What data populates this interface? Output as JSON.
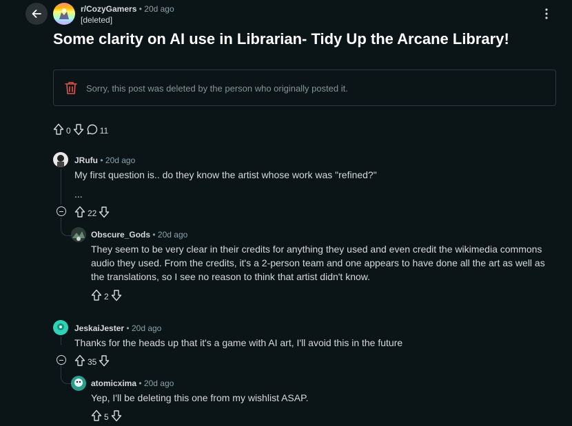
{
  "post": {
    "subreddit": "r/CozyGamers",
    "separator": "•",
    "age": "20d ago",
    "author": "[deleted]",
    "title": "Some clarity on AI use in Librarian- Tidy Up the Arcane Library!",
    "deleted_message": "Sorry, this post was deleted by the person who originally posted it.",
    "votes": "0",
    "comments": "11"
  },
  "comments": [
    {
      "author": "JRufu",
      "age": "20d ago",
      "body": "My first question is.. do they know the artist whose work was \"refined?\"",
      "body2": "...",
      "votes": "22",
      "avatar_color": "#e8e8e8"
    },
    {
      "author": "Obscure_Gods",
      "age": "20d ago",
      "body": "They seem to be very clear in their credits for anything they used and even credit the wikimedia commons audio they used. From the credits, it's a 2-person team and one appears to have done all the art as well as the translations, so I see no reason to think that artist didn't know.",
      "votes": "2",
      "avatar_color": "#2b3b33"
    },
    {
      "author": "JeskaiJester",
      "age": "20d ago",
      "body": "Thanks for the heads up that it's a game with AI art, I'll avoid this in the future",
      "votes": "35",
      "avatar_color": "#2ed3b7"
    },
    {
      "author": "atomicxima",
      "age": "20d ago",
      "body": "Yep, I'll be deleting this one from my wishlist ASAP.",
      "votes": "5",
      "avatar_color": "#2a9d8f"
    }
  ],
  "colors": {
    "background": "#0b1416",
    "meta": "#8ba2ad",
    "danger": "#e5534b"
  },
  "icons": [
    "back-arrow-icon",
    "more-icon",
    "trash-icon",
    "upvote-icon",
    "downvote-icon",
    "comment-icon",
    "collapse-icon"
  ]
}
